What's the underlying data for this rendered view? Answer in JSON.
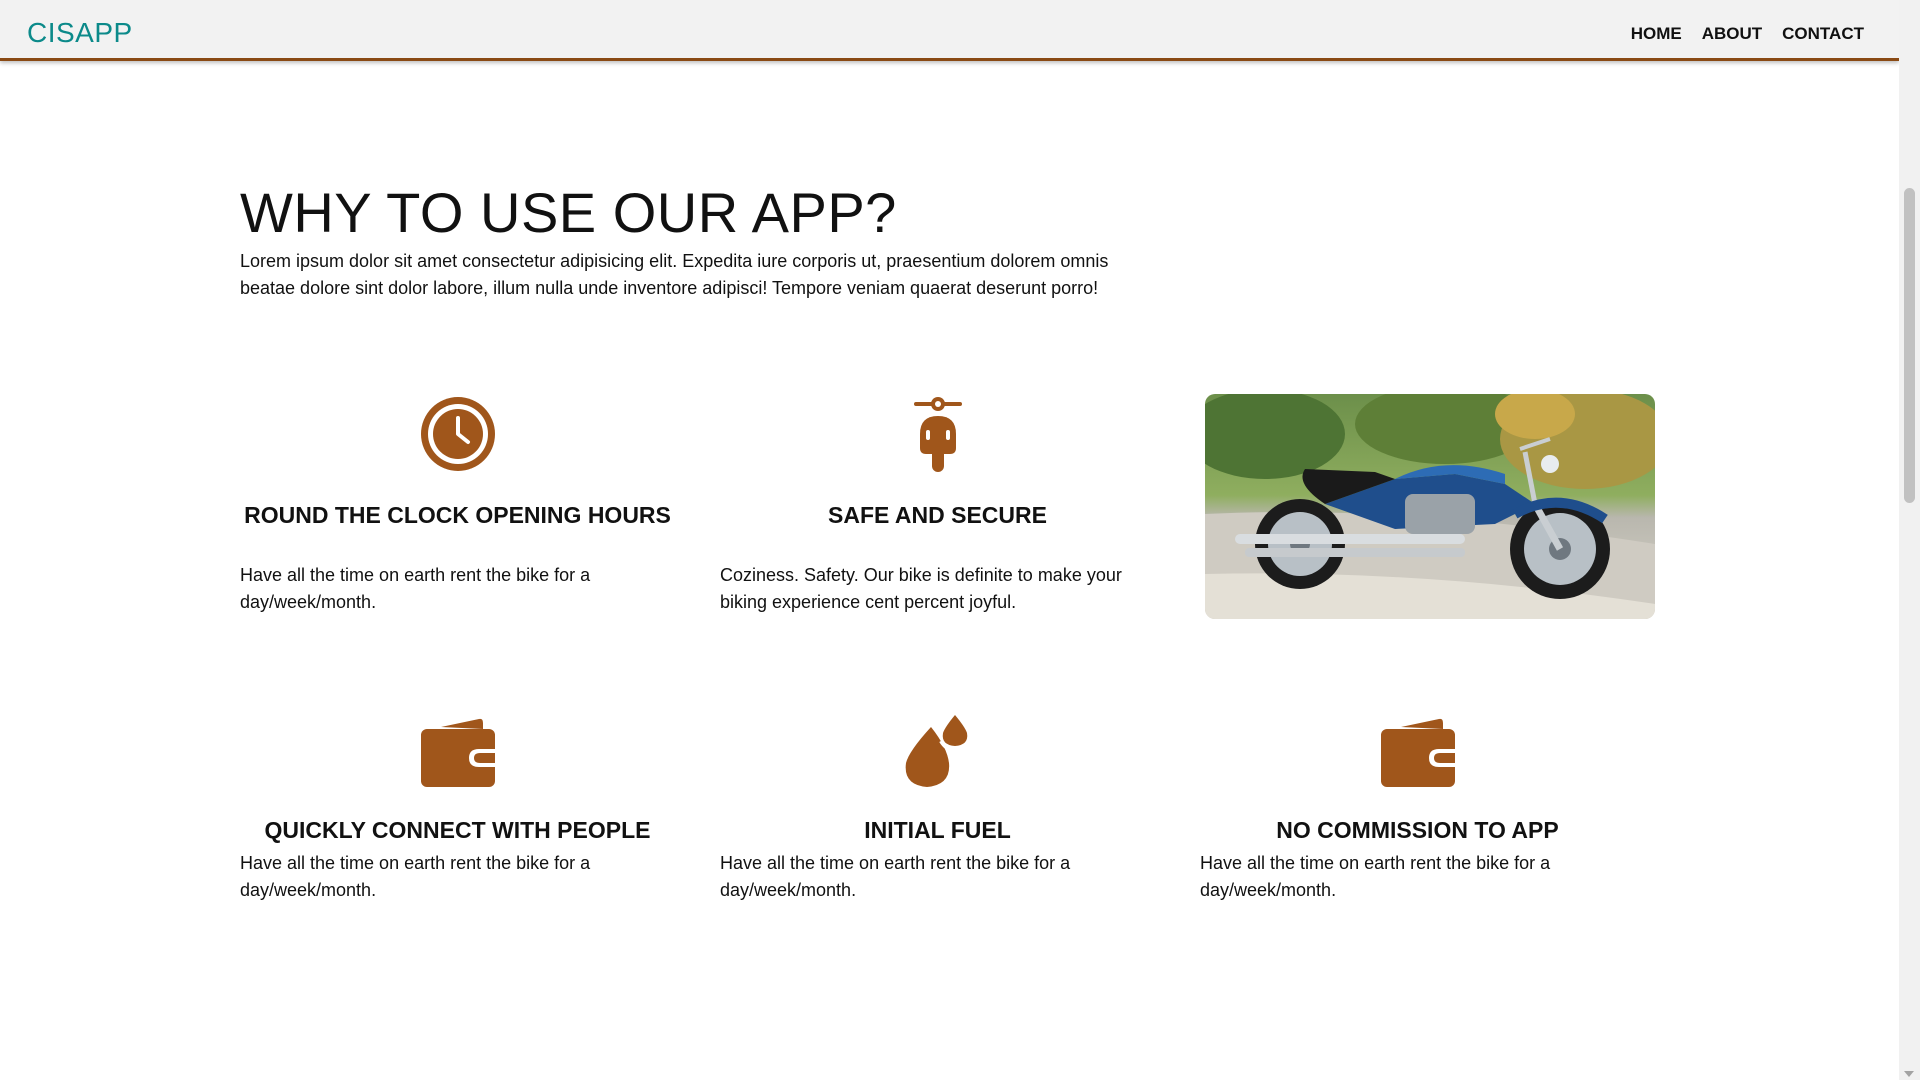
{
  "navbar": {
    "brand": "CISAPP",
    "links": [
      "HOME",
      "ABOUT",
      "CONTACT"
    ]
  },
  "section": {
    "title": "WHY TO USE OUR APP?",
    "intro": "Lorem ipsum dolor sit amet consectetur adipisicing elit. Expedita iure corporis ut, praesentium dolorem omnis beatae dolore sint dolor labore, illum nulla unde inventore adipisci! Tempore veniam quaerat deserunt porro!"
  },
  "features": [
    {
      "icon": "clock-icon",
      "title": "ROUND THE CLOCK OPENING HOURS",
      "text": "Have all the time on earth rent the bike for a day/week/month."
    },
    {
      "icon": "scooter-icon",
      "title": "SAFE AND SECURE",
      "text": "Coziness. Safety. Our bike is definite to make your biking experience cent percent joyful."
    },
    {
      "icon": "wallet-icon",
      "title": "QUICKLY CONNECT WITH PEOPLE",
      "text": "Have all the time on earth rent the bike for a day/week/month."
    },
    {
      "icon": "fuel-drops-icon",
      "title": "INITIAL FUEL",
      "text": "Have all the time on earth rent the bike for a day/week/month."
    },
    {
      "icon": "wallet-icon",
      "title": "NO COMMISSION TO APP",
      "text": "Have all the time on earth rent the bike for a day/week/month."
    }
  ],
  "image": {
    "subject": "blue motorcycle photo"
  },
  "colors": {
    "brand": "#0c8a8a",
    "accent": "#a0561b",
    "nav_border": "#8a4a14",
    "nav_bg": "#f2f2f2"
  }
}
